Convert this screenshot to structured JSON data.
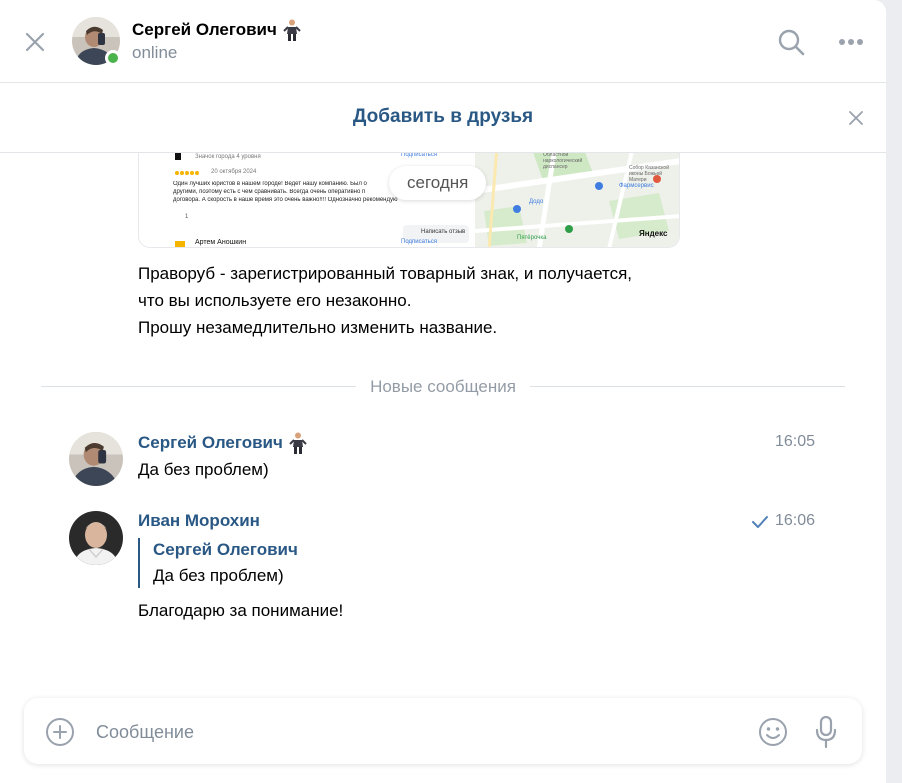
{
  "header": {
    "name": "Сергей Олегович",
    "status": "online"
  },
  "banner": {
    "add_friend": "Добавить в друзья"
  },
  "preview": {
    "badge": "Значок города 4 уровня",
    "subscribe_1": "Подписаться",
    "rating_date": "20 октября 2024",
    "review_line1": "Один лучших юристов в нашем городе! Ведет нашу компанию. Был о",
    "review_line2": "другими, поэтому есть с чем сравнивать. Всегда очень оперативно п",
    "review_line3": "договора. А скорость в наше время это очень важно!!!! Однозначно рекомендую",
    "likes": "1",
    "write_review": "Написать отзыв",
    "reviewer2": "Артем Аношкин",
    "subscribe_2": "Подписаться",
    "map_label_1": "Областной наркологический диспансер",
    "map_label_2": "Фармсервис",
    "map_label_3": "Собор Казанской иконы Божьей Матери",
    "map_label_4": "Пятёрочка",
    "map_label_5": "Додо",
    "map_label_6": "Яндекс",
    "today_label": "сегодня"
  },
  "messages": {
    "previous_lines": [
      "Праворуб - зарегистрированный товарный знак, и получается,",
      "что вы используете его незаконно.",
      "Прошу незамедлительно изменить название."
    ],
    "divider": "Новые сообщения",
    "m1": {
      "author": "Сергей Олегович",
      "time": "16:05",
      "text": "Да без проблем)"
    },
    "m2": {
      "author": "Иван Морохин",
      "time": "16:06",
      "reply_author": "Сергей Олегович",
      "reply_text": "Да без проблем)",
      "text": "Благодарю за понимание!"
    }
  },
  "composer": {
    "placeholder": "Сообщение"
  },
  "colors": {
    "link": "#2a5885",
    "accent": "#5181b8",
    "online": "#4bb34b",
    "secondary_text": "#818c99"
  }
}
